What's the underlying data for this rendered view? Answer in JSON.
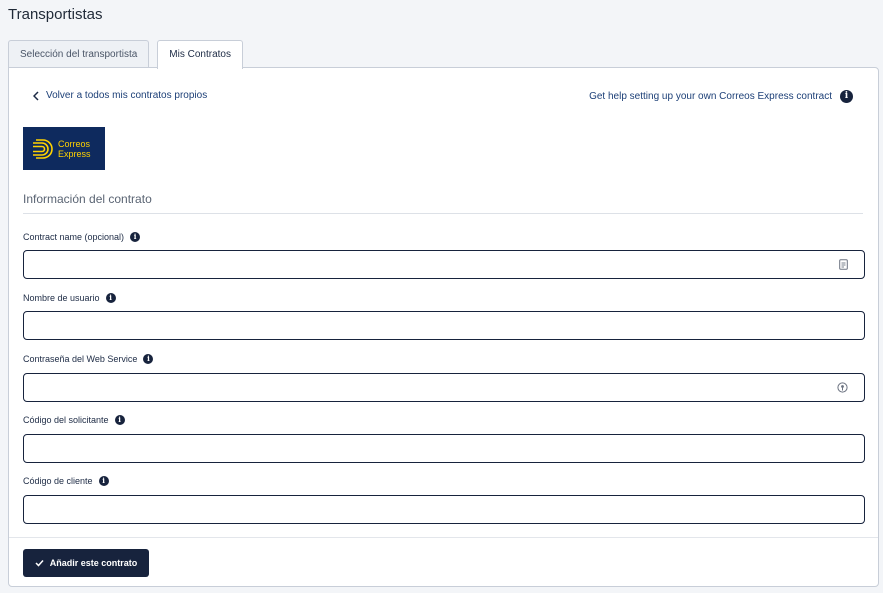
{
  "page": {
    "title": "Transportistas"
  },
  "tabs": [
    {
      "label": "Selección del transportista",
      "active": false
    },
    {
      "label": "Mis Contratos",
      "active": true
    }
  ],
  "links": {
    "back": "Volver a todos mis contratos propios",
    "help": "Get help setting up your own Correos Express contract"
  },
  "carrier": {
    "logo_line1": "Correos",
    "logo_line2": "Express"
  },
  "section": {
    "title": "Información del contrato"
  },
  "fields": [
    {
      "label": "Contract name (opcional)",
      "value": "",
      "icon": "contact-card-icon"
    },
    {
      "label": "Nombre de usuario",
      "value": ""
    },
    {
      "label": "Contraseña del Web Service",
      "value": "",
      "icon": "password-key-icon"
    },
    {
      "label": "Código del solicitante",
      "value": ""
    },
    {
      "label": "Código de cliente",
      "value": ""
    }
  ],
  "actions": {
    "submit_label": "Añadir este contrato"
  },
  "colors": {
    "primary": "#17233d",
    "logo_bg": "#0e2a5e",
    "logo_fg": "#ffd200"
  }
}
